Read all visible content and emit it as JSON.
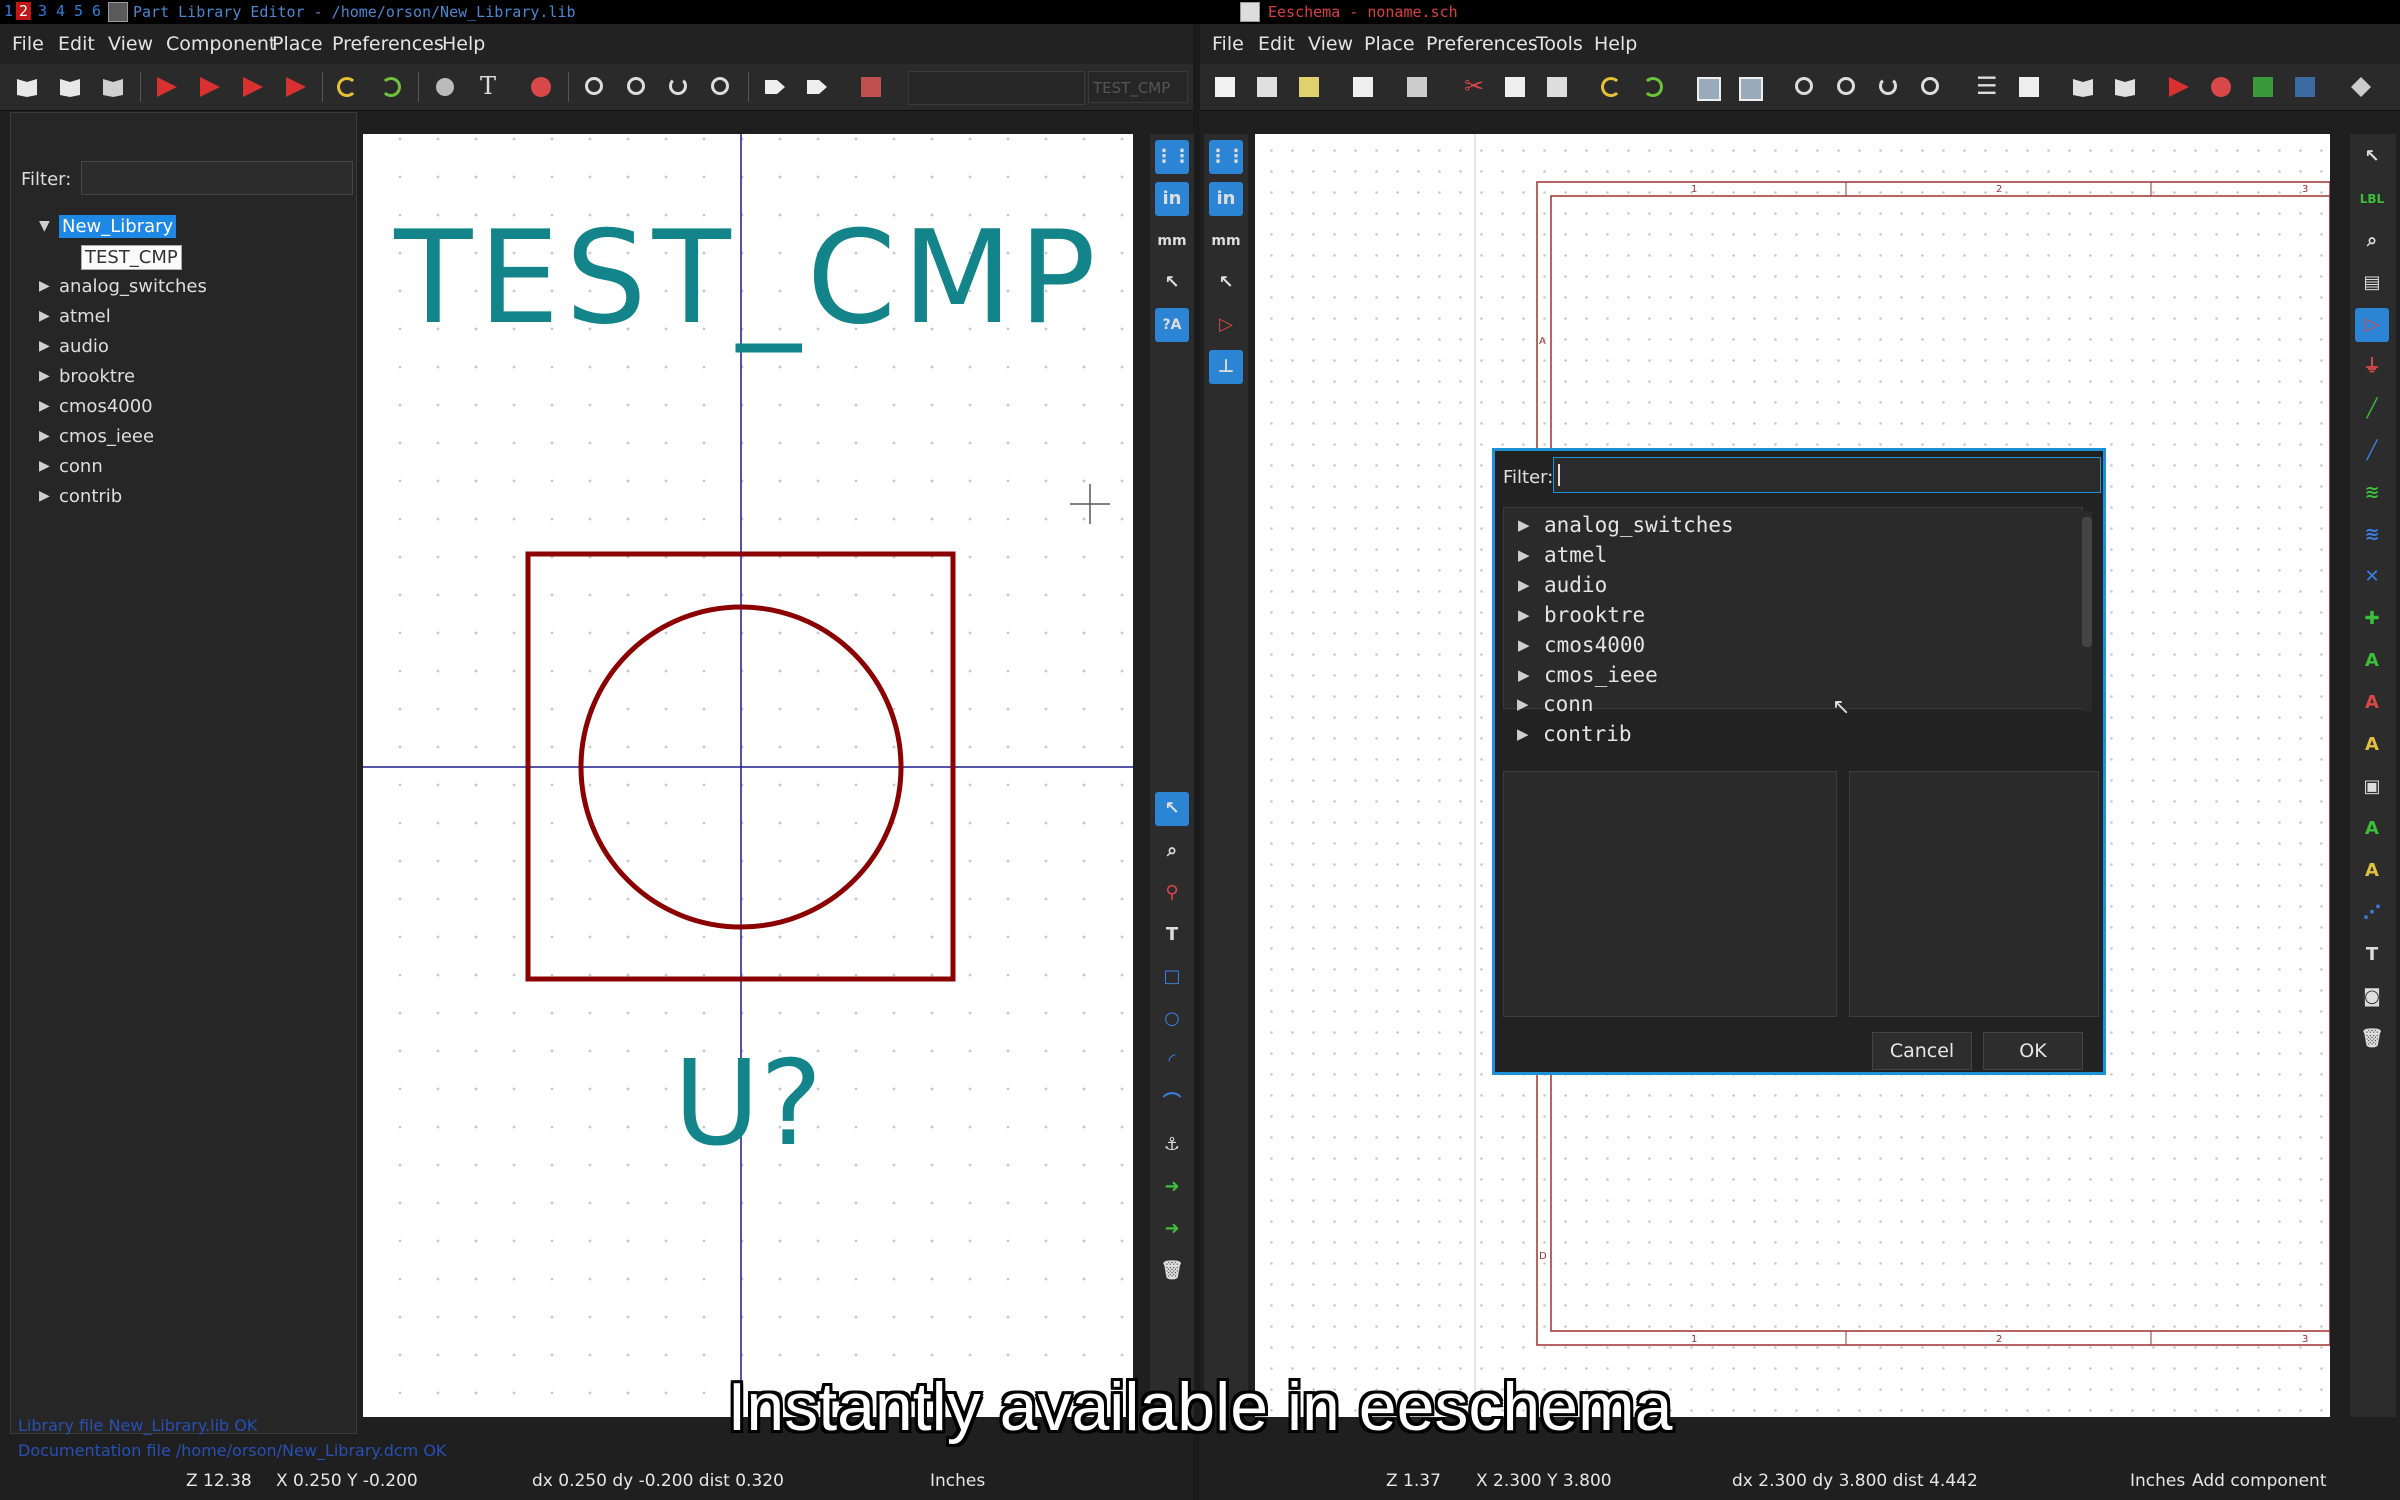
{
  "system_bar": {
    "workspaces": [
      "1",
      "2",
      "3",
      "4",
      "5",
      "6"
    ],
    "active_workspace": "2",
    "left_window_title": "Part Library Editor - /home/orson/New_Library.lib",
    "right_window_title": "Eeschema - noname.sch"
  },
  "part_library_editor": {
    "menu": [
      "File",
      "Edit",
      "View",
      "Component",
      "Place",
      "Preferences",
      "Help"
    ],
    "toolbar_combo_text": "TEST_CMP",
    "filter_label": "Filter:",
    "filter_value": "",
    "tree": {
      "library": "New_Library",
      "component": "TEST_CMP",
      "libraries": [
        "analog_switches",
        "atmel",
        "audio",
        "brooktre",
        "cmos4000",
        "cmos_ieee",
        "conn",
        "contrib"
      ]
    },
    "canvas": {
      "component_name": "TEST_CMP",
      "reference": "U?"
    },
    "messages": [
      "Library file New_Library.lib OK",
      "Documentation file /home/orson/New_Library.dcm OK"
    ],
    "status": {
      "zoom": "Z 12.38",
      "cursor": "X 0.250  Y -0.200",
      "delta": "dx 0.250  dy -0.200  dist 0.320",
      "units": "Inches"
    }
  },
  "eeschema": {
    "menu": [
      "File",
      "Edit",
      "View",
      "Place",
      "Preferences",
      "Tools",
      "Help"
    ],
    "sheet": {
      "top_columns": [
        "1",
        "2",
        "3"
      ],
      "bottom_columns": [
        "1",
        "2",
        "3"
      ],
      "rows": [
        "A",
        "D"
      ]
    },
    "status": {
      "zoom": "Z 1.37",
      "cursor": "X 2.300  Y 3.800",
      "delta": "dx 2.300  dy 3.800  dist 4.442",
      "units": "Inches",
      "mode": "Add component"
    }
  },
  "dialog": {
    "filter_label": "Filter:",
    "filter_value": "",
    "libraries": [
      "analog_switches",
      "atmel",
      "audio",
      "brooktre",
      "cmos4000",
      "cmos_ieee",
      "conn",
      "contrib"
    ],
    "cancel_label": "Cancel",
    "ok_label": "OK"
  },
  "caption": "Instantly available in eeschema",
  "colors": {
    "accent": "#1e88e5",
    "component_text": "#13848a",
    "component_body": "#8b0000",
    "sheet_frame": "#8b2222",
    "status_message": "#2850b4"
  }
}
